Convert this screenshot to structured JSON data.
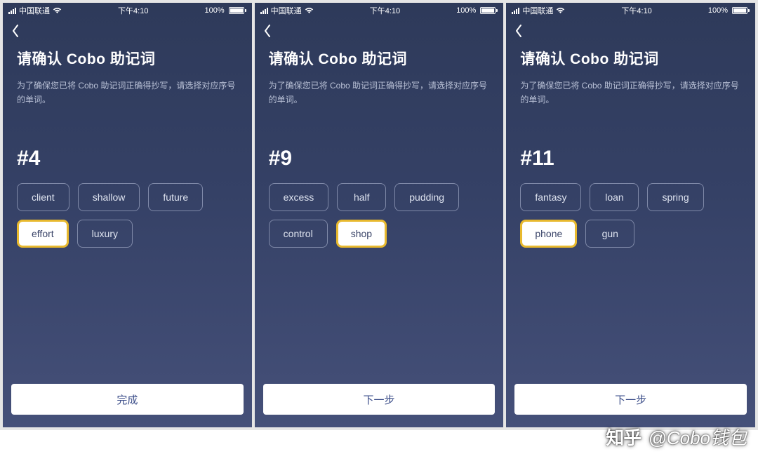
{
  "status": {
    "carrier": "中国联通",
    "time": "下午4:10",
    "battery_pct": "100%"
  },
  "common": {
    "title": "请确认 Cobo 助记词",
    "subtitle": "为了确保您已将 Cobo 助记词正确得抄写，请选择对应序号的单词。"
  },
  "screens": [
    {
      "number": "#4",
      "words": [
        "client",
        "shallow",
        "future",
        "effort",
        "luxury"
      ],
      "selected_index": 3,
      "button": "完成"
    },
    {
      "number": "#9",
      "words": [
        "excess",
        "half",
        "pudding",
        "control",
        "shop"
      ],
      "selected_index": 4,
      "button": "下一步"
    },
    {
      "number": "#11",
      "words": [
        "fantasy",
        "loan",
        "spring",
        "phone",
        "gun"
      ],
      "selected_index": 3,
      "button": "下一步"
    }
  ],
  "watermark": {
    "logo_text": "知乎",
    "text": "@Cobo钱包"
  }
}
